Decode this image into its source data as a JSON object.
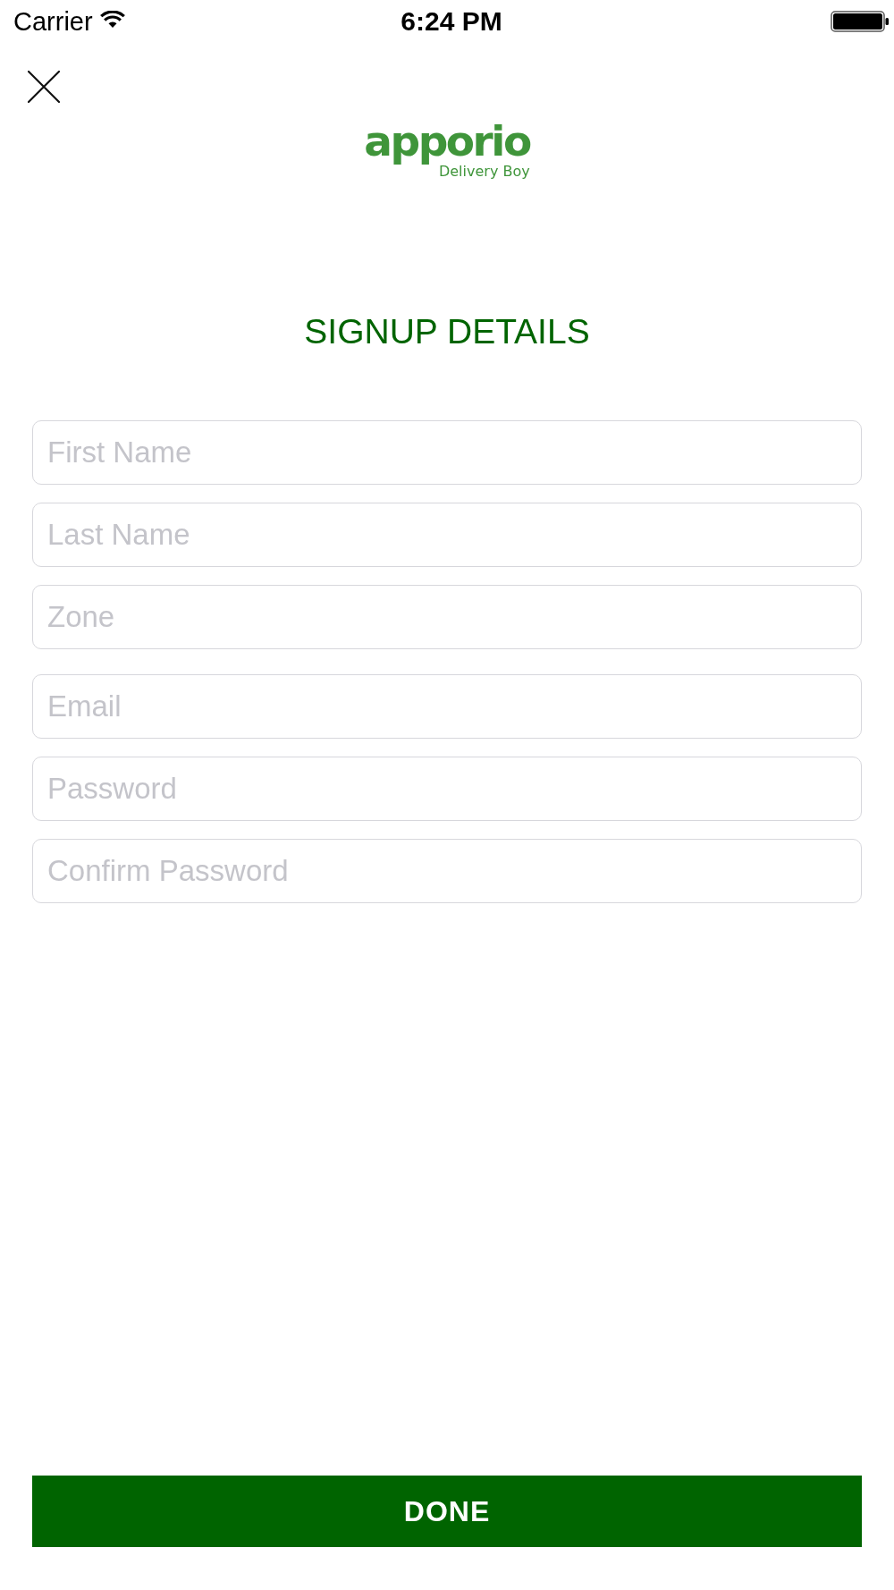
{
  "status_bar": {
    "carrier": "Carrier",
    "time": "6:24 PM"
  },
  "logo": {
    "name": "apporio",
    "tagline": "Delivery Boy"
  },
  "title": "SIGNUP DETAILS",
  "sections": [
    {
      "fields": [
        {
          "placeholder": "First Name"
        },
        {
          "placeholder": "Last Name"
        },
        {
          "placeholder": "Zone"
        }
      ]
    },
    {
      "fields": [
        {
          "placeholder": "Email"
        },
        {
          "placeholder": "Password"
        },
        {
          "placeholder": "Confirm Password"
        }
      ]
    }
  ],
  "done_button": {
    "label": "DONE"
  }
}
